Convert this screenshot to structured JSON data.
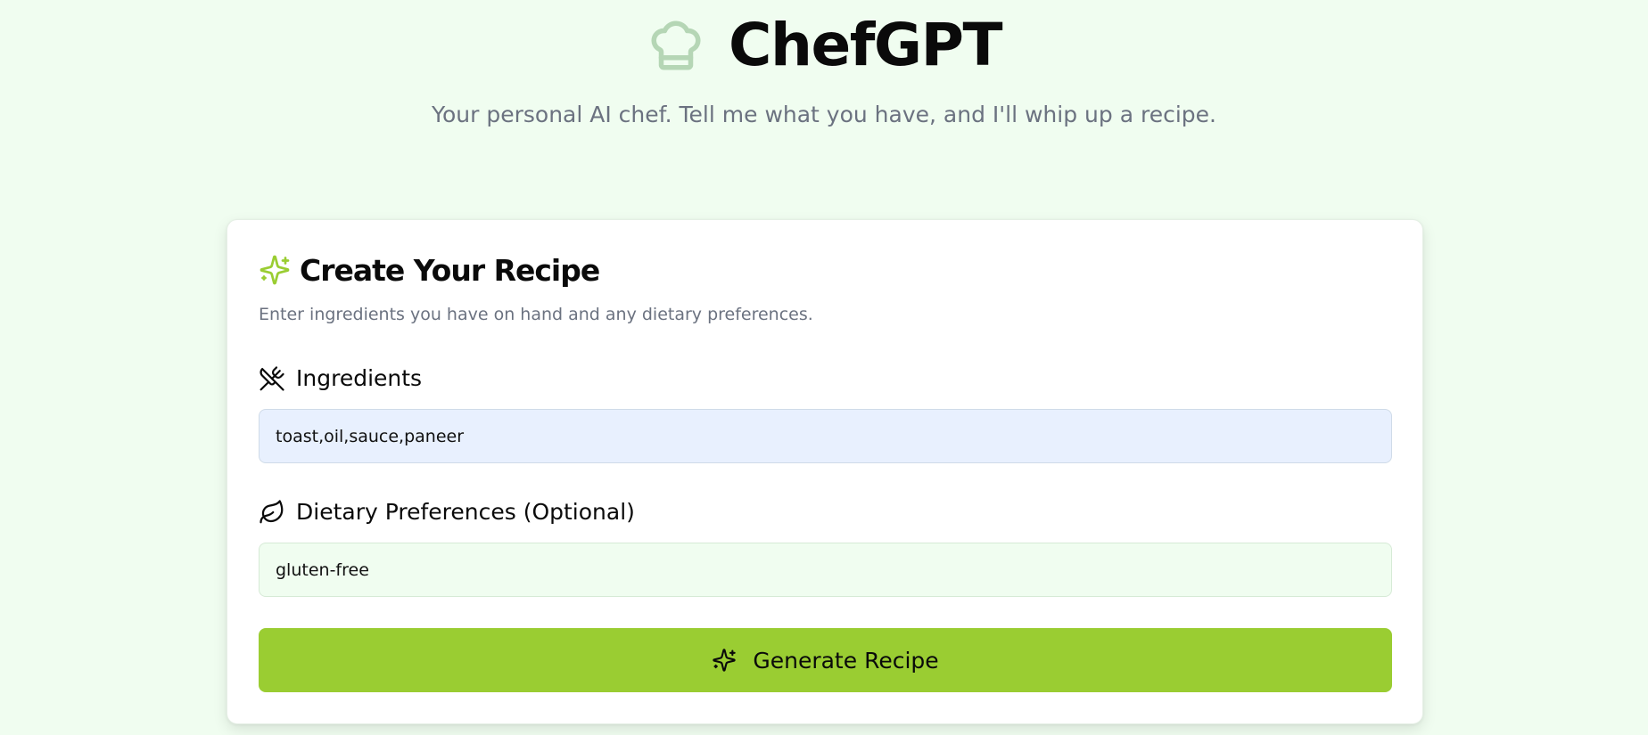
{
  "app": {
    "title": "ChefGPT",
    "tagline": "Your personal AI chef. Tell me what you have, and I'll whip up a recipe.",
    "icon": "chef-hat-icon"
  },
  "card": {
    "title": "Create Your Recipe",
    "title_icon": "sparkles-icon",
    "subtitle": "Enter ingredients you have on hand and any dietary preferences."
  },
  "form": {
    "ingredients": {
      "label": "Ingredients",
      "icon": "utensils-crossed-icon",
      "value": "toast,oil,sauce,paneer"
    },
    "dietary": {
      "label": "Dietary Preferences (Optional)",
      "icon": "leaf-icon",
      "value": "gluten-free"
    },
    "submit": {
      "label": "Generate Recipe",
      "icon": "sparkles-icon"
    }
  },
  "colors": {
    "background": "#f0fdf0",
    "accent": "#9acd32",
    "chef_icon": "#b5d6b5",
    "ingredients_input_bg": "#e8f0fe",
    "dietary_input_bg": "#f0fdf0"
  }
}
